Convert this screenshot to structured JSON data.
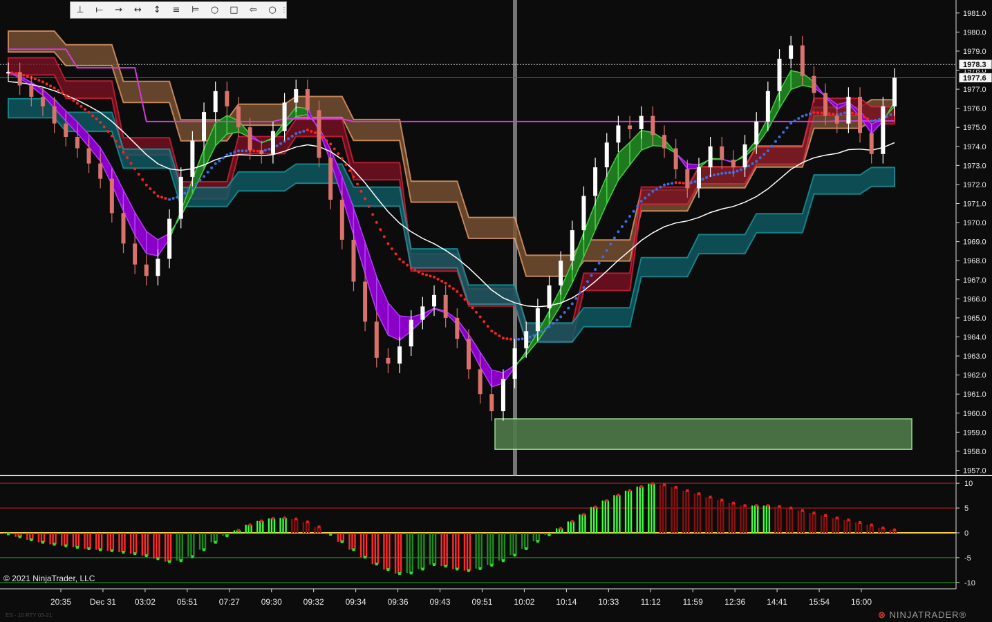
{
  "toolbar": {
    "tools": [
      {
        "name": "ruler-tool",
        "icon": "ruler-icon",
        "glyph": "⊥"
      },
      {
        "name": "line-tool",
        "icon": "line-icon",
        "glyph": "⟝"
      },
      {
        "name": "ray-tool",
        "icon": "ray-icon",
        "glyph": "→"
      },
      {
        "name": "extended-line-tool",
        "icon": "extended-line-icon",
        "glyph": "↔"
      },
      {
        "name": "vertical-line-tool",
        "icon": "vertical-line-icon",
        "glyph": "↕"
      },
      {
        "name": "horizontal-lines-tool",
        "icon": "horizontal-lines-icon",
        "glyph": "≡"
      },
      {
        "name": "fibonacci-tool",
        "icon": "fibonacci-icon",
        "glyph": "⊨"
      },
      {
        "name": "ellipse-tool",
        "icon": "ellipse-icon",
        "glyph": "○"
      },
      {
        "name": "rectangle-tool",
        "icon": "rectangle-icon",
        "glyph": "□"
      },
      {
        "name": "arrow-tool",
        "icon": "arrow-icon",
        "glyph": "⇦"
      },
      {
        "name": "circle-tool",
        "icon": "circle-icon",
        "glyph": "○"
      }
    ],
    "grip_glyph": "⋮"
  },
  "footer": {
    "copyright": "© 2021 NinjaTrader, LLC",
    "logo_mark": "⊗",
    "logo_text": "NINJATRADER®",
    "corner_label": "ES - 10   RTY 03-21"
  },
  "colors": {
    "background": "#0c0c0c",
    "up_candle": "#ffffff",
    "down_candle": "#d9726a",
    "green_ribbon": "#1f7a1f",
    "purple_ribbon": "#8a00c8",
    "red_cloud": "#7a1022",
    "orange_cloud": "#7a5232",
    "teal_cloud": "#0f5d66",
    "magenta_line": "#d43ae0",
    "blue_dots": "#3b6ee0",
    "red_dots": "#ff2020",
    "zone": "#4f7a4a"
  },
  "chart_data": [
    {
      "type": "candlestick",
      "title": "",
      "ylim": [
        1956.8,
        1981.5
      ],
      "y_ticks": [
        "1957.0",
        "1958.0",
        "1959.0",
        "1960.0",
        "1961.0",
        "1962.0",
        "1963.0",
        "1964.0",
        "1965.0",
        "1966.0",
        "1967.0",
        "1968.0",
        "1969.0",
        "1970.0",
        "1971.0",
        "1972.0",
        "1973.0",
        "1974.0",
        "1975.0",
        "1976.0",
        "1977.0",
        "1978.0",
        "1979.0",
        "1980.0",
        "1981.0"
      ],
      "x_ticks": [
        "20:35",
        "Dec 31",
        "03:02",
        "05:51",
        "07:27",
        "09:30",
        "09:32",
        "09:34",
        "09:36",
        "09:43",
        "09:51",
        "10:02",
        "10:14",
        "10:33",
        "11:12",
        "11:59",
        "12:36",
        "14:41",
        "15:54",
        "16:00"
      ],
      "price_labels": [
        {
          "value": 1978.3,
          "label": "1978.3"
        },
        {
          "value": 1977.6,
          "label": "1977.6"
        }
      ],
      "close_series": [
        1977.9,
        1977.2,
        1976.6,
        1976.1,
        1975.2,
        1974.5,
        1973.9,
        1973.1,
        1972.3,
        1970.5,
        1968.9,
        1967.8,
        1967.2,
        1968.1,
        1970.2,
        1972.4,
        1974.3,
        1975.8,
        1976.9,
        1976.1,
        1975.0,
        1973.8,
        1973.6,
        1974.8,
        1976.3,
        1977.0,
        1975.9,
        1973.4,
        1971.2,
        1969.1,
        1966.9,
        1964.8,
        1962.9,
        1962.6,
        1963.5,
        1964.9,
        1965.6,
        1966.2,
        1965.0,
        1963.9,
        1962.3,
        1961.0,
        1960.1,
        1961.8,
        1963.4,
        1964.3,
        1965.5,
        1966.7,
        1968.0,
        1969.6,
        1971.4,
        1972.9,
        1974.2,
        1975.1,
        1974.9,
        1975.6,
        1974.6,
        1973.9,
        1972.8,
        1971.8,
        1972.9,
        1974.0,
        1973.3,
        1972.9,
        1974.1,
        1975.3,
        1976.9,
        1978.6,
        1979.3,
        1977.7,
        1976.8,
        1975.6,
        1975.2,
        1976.6,
        1974.7,
        1973.6,
        1976.1,
        1977.6
      ]
    },
    {
      "type": "bar",
      "title": "",
      "ylim": [
        -11,
        11
      ],
      "y_ticks": [
        "10",
        "5",
        "0",
        "-5",
        "-10"
      ],
      "reference_lines": [
        10,
        5,
        0,
        -5,
        -10
      ],
      "values": [
        -0.2,
        -0.8,
        -1.4,
        -1.9,
        -2.3,
        -2.6,
        -2.9,
        -3.2,
        -3.4,
        -3.6,
        -3.9,
        -4.2,
        -4.6,
        -5.2,
        -5.8,
        -5.6,
        -4.8,
        -3.4,
        -1.9,
        -0.6,
        0.5,
        1.6,
        2.4,
        2.9,
        3.0,
        2.8,
        2.2,
        1.2,
        -0.3,
        -1.8,
        -3.4,
        -4.9,
        -6.3,
        -7.4,
        -8.2,
        -8.1,
        -7.3,
        -6.4,
        -6.7,
        -7.3,
        -7.6,
        -7.2,
        -6.5,
        -5.6,
        -4.5,
        -3.2,
        -1.7,
        -0.4,
        0.9,
        2.3,
        3.7,
        5.2,
        6.5,
        7.6,
        8.5,
        9.3,
        9.9,
        9.7,
        9.2,
        8.5,
        7.9,
        7.2,
        6.6,
        6.0,
        5.5,
        5.5,
        5.5,
        5.3,
        5.0,
        4.5,
        4.0,
        3.5,
        3.0,
        2.6,
        2.1,
        1.6,
        1.0,
        0.6
      ]
    }
  ]
}
